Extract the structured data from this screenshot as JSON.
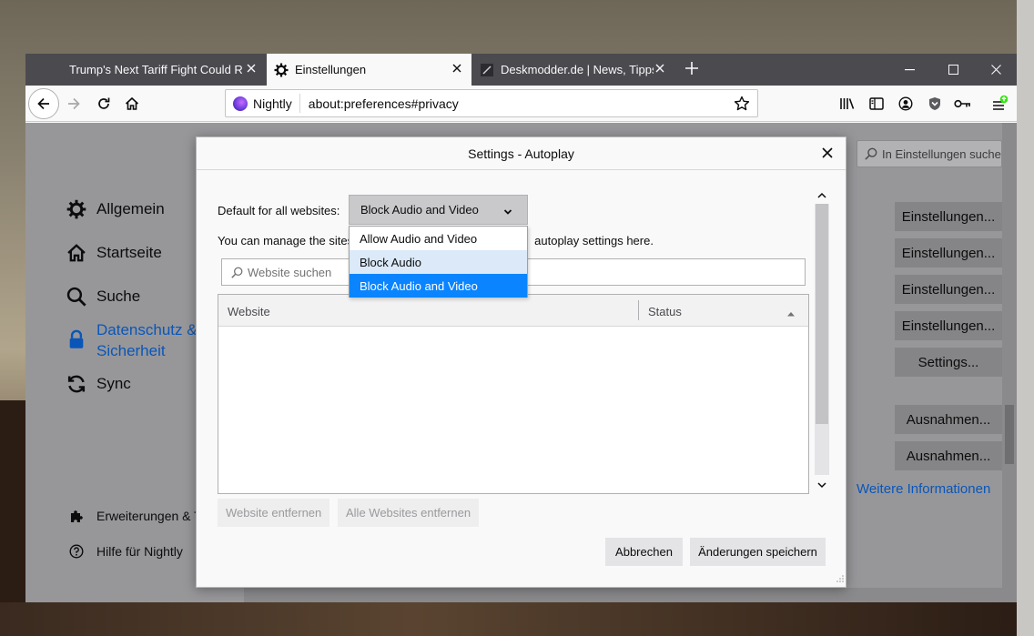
{
  "tabs": [
    {
      "title": "Trump's Next Tariff Fight Could Rea"
    },
    {
      "title": "Einstellungen"
    },
    {
      "title": "Deskmodder.de | News, Tipps u"
    }
  ],
  "urlbar": {
    "identity": "Nightly",
    "url": "about:preferences#privacy"
  },
  "sidebar": {
    "items": [
      {
        "label": "Allgemein",
        "icon": "gear-icon"
      },
      {
        "label": "Startseite",
        "icon": "home-icon"
      },
      {
        "label": "Suche",
        "icon": "search-icon"
      },
      {
        "label": "Datenschutz &",
        "label2": "Sicherheit",
        "icon": "lock-icon"
      },
      {
        "label": "Sync",
        "icon": "sync-icon"
      }
    ],
    "footer": [
      {
        "label": "Erweiterungen & T",
        "icon": "puzzle-icon"
      },
      {
        "label": "Hilfe für Nightly",
        "icon": "help-icon"
      }
    ]
  },
  "prefs": {
    "search_placeholder": "In Einstellungen suchen",
    "buttons": [
      "Einstellungen...",
      "Einstellungen...",
      "Einstellungen...",
      "Einstellungen...",
      "Settings...",
      "Ausnahmen...",
      "Ausnahmen..."
    ],
    "more_info": "Weitere Informationen"
  },
  "dialog": {
    "title": "Settings - Autoplay",
    "default_label": "Default for all websites:",
    "default_value": "Block Audio and Video",
    "manage_text_before": "You can manage the sites",
    "manage_text_after": "autoplay settings here.",
    "search_placeholder": "Website suchen",
    "columns": {
      "website": "Website",
      "status": "Status"
    },
    "remove_site": "Website entfernen",
    "remove_all": "Alle Websites entfernen",
    "cancel": "Abbrechen",
    "save": "Änderungen speichern"
  },
  "dropdown": {
    "options": [
      "Allow Audio and Video",
      "Block Audio",
      "Block Audio and Video"
    ],
    "hovered_index": 1,
    "selected_index": 2
  },
  "colors": {
    "accent": "#0a84ff",
    "link": "#0a56b8"
  }
}
